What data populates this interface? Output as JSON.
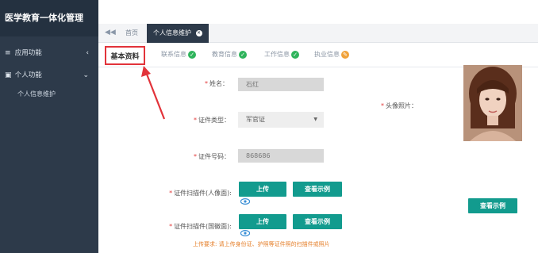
{
  "app": {
    "title": "医学教育一体化管理"
  },
  "sidebar": {
    "items": [
      {
        "label": "应用功能",
        "icon": "menu-icon"
      },
      {
        "label": "个人功能",
        "icon": "person-icon"
      }
    ],
    "sub_items": [
      {
        "label": "个人信息维护"
      }
    ]
  },
  "tabs": {
    "home": "首页",
    "active": "个人信息维护"
  },
  "subtabs": {
    "active": "基本资料",
    "items": [
      {
        "label": "联系信息",
        "status": "ok"
      },
      {
        "label": "教育信息",
        "status": "ok"
      },
      {
        "label": "工作信息",
        "status": "ok"
      },
      {
        "label": "执业信息",
        "status": "warn"
      }
    ]
  },
  "form": {
    "name_label": "姓名：",
    "name_value": "石红",
    "idtype_label": "证件类型：",
    "idtype_value": "军官证",
    "idnum_label": "证件号码：",
    "idnum_value": "868686",
    "scan_front_label": "证件扫描件(人像面):",
    "scan_back_label": "证件扫描件(国徽面):",
    "photo_label": "头像照片：",
    "upload_label": "上传",
    "example_label": "查看示例",
    "hint": "上传要求: 请上传身份证、护照等证件照的扫描件或照片"
  },
  "colors": {
    "sidebar": "#2d3a4a",
    "accent": "#129b8e",
    "highlight": "#e2333a",
    "ok": "#2fb45c",
    "warn": "#f0a23a"
  }
}
